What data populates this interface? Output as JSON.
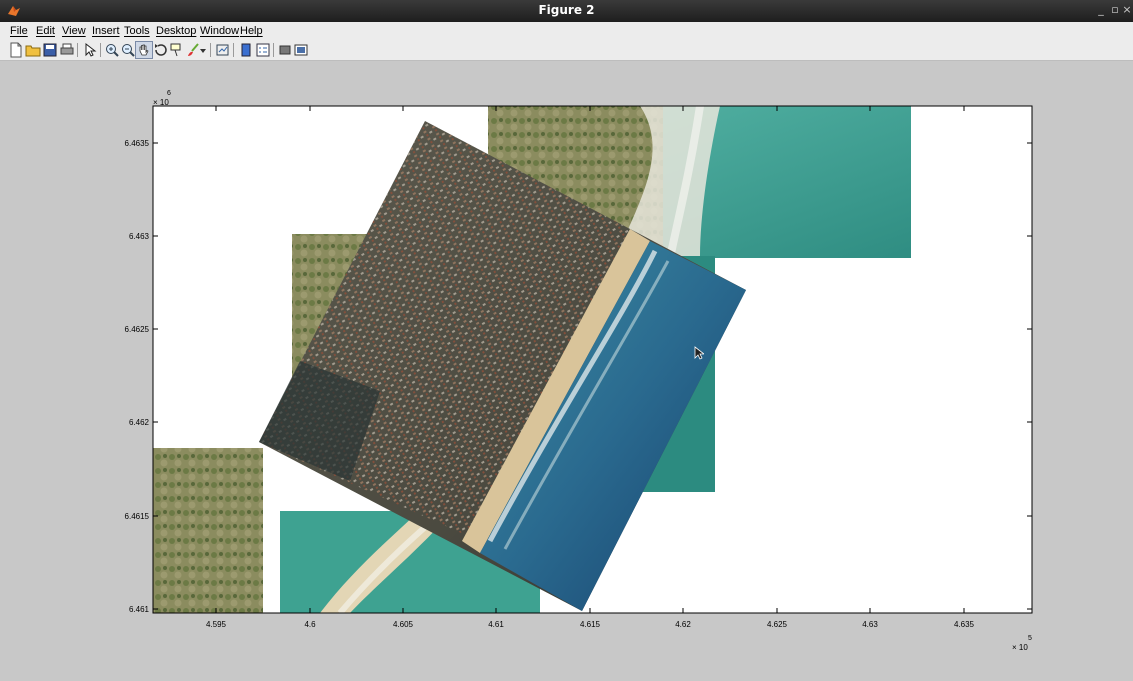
{
  "window": {
    "title": "Figure 2",
    "controls": [
      "_",
      "▫",
      "×"
    ]
  },
  "menu": [
    {
      "label": "File"
    },
    {
      "label": "Edit"
    },
    {
      "label": "View"
    },
    {
      "label": "Insert"
    },
    {
      "label": "Tools"
    },
    {
      "label": "Desktop"
    },
    {
      "label": "Window"
    },
    {
      "label": "Help"
    }
  ],
  "toolbar": [
    "new-figure-icon",
    "open-file-icon",
    "save-icon",
    "print-icon",
    "select-arrow-icon",
    "zoom-in-icon",
    "zoom-out-icon",
    "pan-hand-icon",
    "rotate-3d-icon",
    "data-cursor-icon",
    "brush-icon",
    "brush-dropdown-icon",
    "link-plot-icon",
    "insert-colorbar-icon",
    "insert-legend-icon",
    "hide-plot-tools-icon",
    "show-plot-tools-icon"
  ],
  "axes": {
    "y_exponent_base": "× 10",
    "y_exponent_power": "6",
    "x_exponent_base": "× 10",
    "x_exponent_power": "5",
    "x_ticks": [
      "4.595",
      "4.6",
      "4.605",
      "4.61",
      "4.615",
      "4.62",
      "4.625",
      "4.63",
      "4.635"
    ],
    "y_ticks": [
      "6.4635",
      "6.463",
      "6.4625",
      "6.462",
      "6.4615",
      "6.461"
    ]
  },
  "colors": {
    "ocean": "#2f9a8a",
    "deep_ocean": "#1e4f78",
    "urban": "#5b5246",
    "vegetation": "#7f8a55",
    "sand": "#d9c49a"
  }
}
